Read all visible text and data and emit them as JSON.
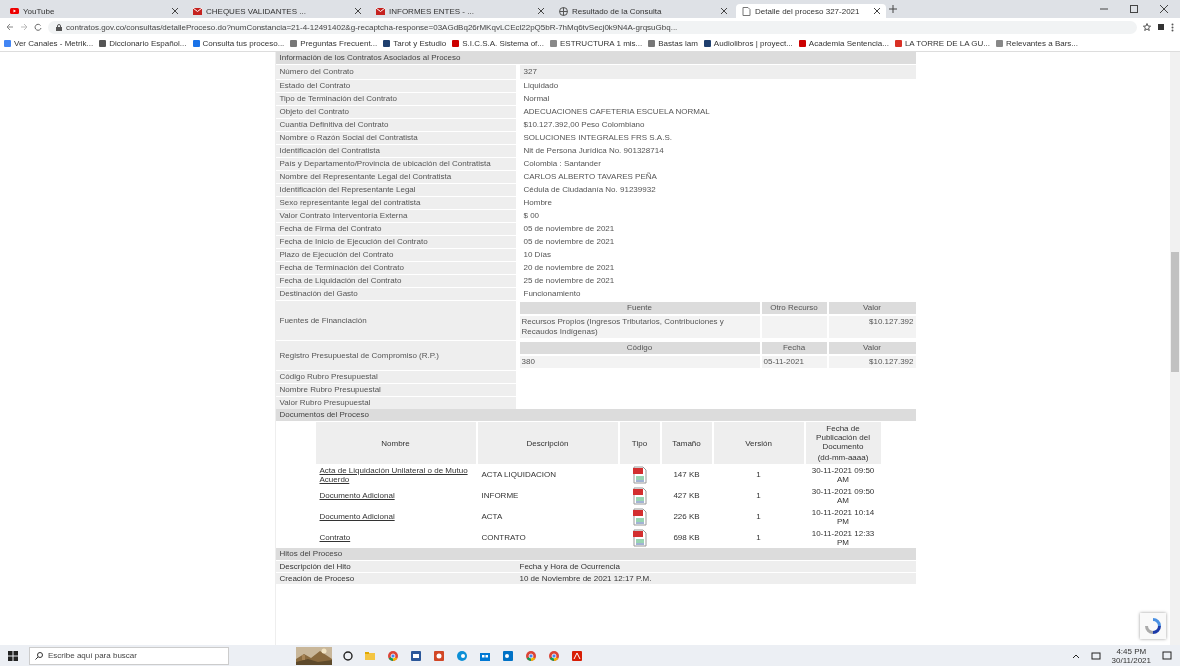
{
  "browser": {
    "tabs": [
      {
        "title": "YouTube",
        "selected": false
      },
      {
        "title": "CHEQUES VALIDANTES ...",
        "selected": false
      },
      {
        "title": "INFORMES ENTES - ...",
        "selected": false
      },
      {
        "title": "Resultado de la Consulta",
        "selected": false
      },
      {
        "title": "Detalle del proceso 327-2021",
        "selected": true
      }
    ],
    "url": "contratos.gov.co/consultas/detalleProceso.do?numConstancia=21-4-12491402&g-recaptcha-response=03AGdBq26rMKqvLCEcl22pQ5bR-7hMq6tvSecj0k9N4A-grqsuGbq...",
    "bookmarks": [
      "Ver Canales - Metrik...",
      "Diccionario Español...",
      "Consulta tus proceso...",
      "Preguntas Frecuent...",
      "Tarot y Estudio",
      "S.I.C.S.A. Sistema of...",
      "ESTRUCTURA 1 mis...",
      "Bastas lam",
      "Audiolibros | proyect...",
      "Academia Sentencia...",
      "LA TORRE DE LA GU...",
      "Relevantes a Bars..."
    ]
  },
  "contract": {
    "title": "Información de los Contratos Asociados al Proceso",
    "fields": [
      {
        "kind": "text",
        "label": "Número del Contrato",
        "value": "327"
      },
      {
        "kind": "text",
        "label": "Estado del Contrato",
        "value": "Liquidado"
      },
      {
        "kind": "text",
        "label": "Tipo de Terminación del Contrato",
        "value": "Normal"
      },
      {
        "kind": "text",
        "label": "Objeto del Contrato",
        "value": "ADECUACIONES CAFETERIA ESCUELA NORMAL"
      },
      {
        "kind": "text",
        "label": "Cuantía Definitiva del Contrato",
        "value": "$10.127.392,00 Peso Colombiano"
      },
      {
        "kind": "text",
        "label": "Nombre o Razón Social del Contratista",
        "value": "SOLUCIONES INTEGRALES FRS S.A.S."
      },
      {
        "kind": "text",
        "label": "Identificación del Contratista",
        "value": "Nit de Persona Jurídica No. 901328714"
      },
      {
        "kind": "text",
        "label": "País y Departamento/Provincia de ubicación del Contratista",
        "value": "Colombia : Santander"
      },
      {
        "kind": "text",
        "label": "Nombre del Representante Legal del Contratista",
        "value": "CARLOS ALBERTO TAVARES PEÑA"
      },
      {
        "kind": "text",
        "label": "Identificación del Representante Legal",
        "value": "Cédula de Ciudadanía No. 91239932"
      },
      {
        "kind": "text",
        "label": "Sexo representante legal del contratista",
        "value": "Hombre"
      },
      {
        "kind": "text",
        "label": "Valor Contrato Interventoría Externa",
        "value": "$ 00"
      },
      {
        "kind": "text",
        "label": "Fecha de Firma del Contrato",
        "value": "05 de noviembre de 2021"
      },
      {
        "kind": "text",
        "label": "Fecha de Inicio de Ejecución del Contrato",
        "value": "05 de noviembre de 2021"
      },
      {
        "kind": "text",
        "label": "Plazo de Ejecución del Contrato",
        "value": "10 Días"
      },
      {
        "kind": "text",
        "label": "Fecha de Terminación del Contrato",
        "value": "20 de noviembre de 2021"
      },
      {
        "kind": "text",
        "label": "Fecha de Liquidación del Contrato",
        "value": "25 de noviembre de 2021"
      },
      {
        "kind": "text",
        "label": "Destinación del Gasto",
        "value": "Funcionamiento"
      },
      {
        "kind": "table",
        "label": "Fuentes de Financiación",
        "columns": [
          "Fuente",
          "Otro Recurso",
          "Valor"
        ],
        "rows": [
          [
            "Recursos Propios (Ingresos Tributarios, Contribuciones y Recaudos Indígenas)",
            "",
            "$10.127.392"
          ]
        ]
      },
      {
        "kind": "table",
        "label": "Registro Presupuestal de Compromiso (R.P.)",
        "columns": [
          "Código",
          "Fecha",
          "Valor"
        ],
        "rows": [
          [
            "380",
            "05-11-2021",
            "$10.127.392"
          ]
        ]
      },
      {
        "kind": "text",
        "label": "Código Rubro Presupuestal"
      },
      {
        "kind": "text",
        "label": "Nombre Rubro Presupuestal"
      },
      {
        "kind": "text",
        "label": "Valor Rubro Presupuestal"
      }
    ]
  },
  "documents": {
    "title": "Documentos del Proceso",
    "columns": [
      "Nombre",
      "Descripción",
      "Tipo",
      "Tamaño",
      "Versión",
      "Fecha de Publicación del Documento"
    ],
    "date_hint": "(dd-mm-aaaa)",
    "rows": [
      {
        "name": "Acta de Liquidación Unilateral o de Mutuo Acuerdo",
        "description": "ACTA LIQUIDACION",
        "size": "147 KB",
        "version": "1",
        "date": "30-11-2021 09:50 AM"
      },
      {
        "name": "Documento Adicional",
        "description": "INFORME",
        "size": "427 KB",
        "version": "1",
        "date": "30-11-2021 09:50 AM"
      },
      {
        "name": "Documento Adicional",
        "description": "ACTA",
        "size": "226 KB",
        "version": "1",
        "date": "10-11-2021 10:14 PM"
      },
      {
        "name": "Contrato",
        "description": "CONTRATO",
        "size": "698 KB",
        "version": "1",
        "date": "10-11-2021 12:33 PM"
      }
    ]
  },
  "milestones": {
    "title": "Hitos del Proceso",
    "rows": [
      {
        "label": "Descripción del Hito",
        "value": "Fecha y Hora de Ocurrencia"
      },
      {
        "label": "Creación de Proceso",
        "value": "10 de Noviembre de 2021 12:17 P.M."
      }
    ]
  },
  "taskbar": {
    "search_placeholder": "Escribe aquí para buscar",
    "time": "4:45 PM",
    "date": "30/11/2021"
  }
}
